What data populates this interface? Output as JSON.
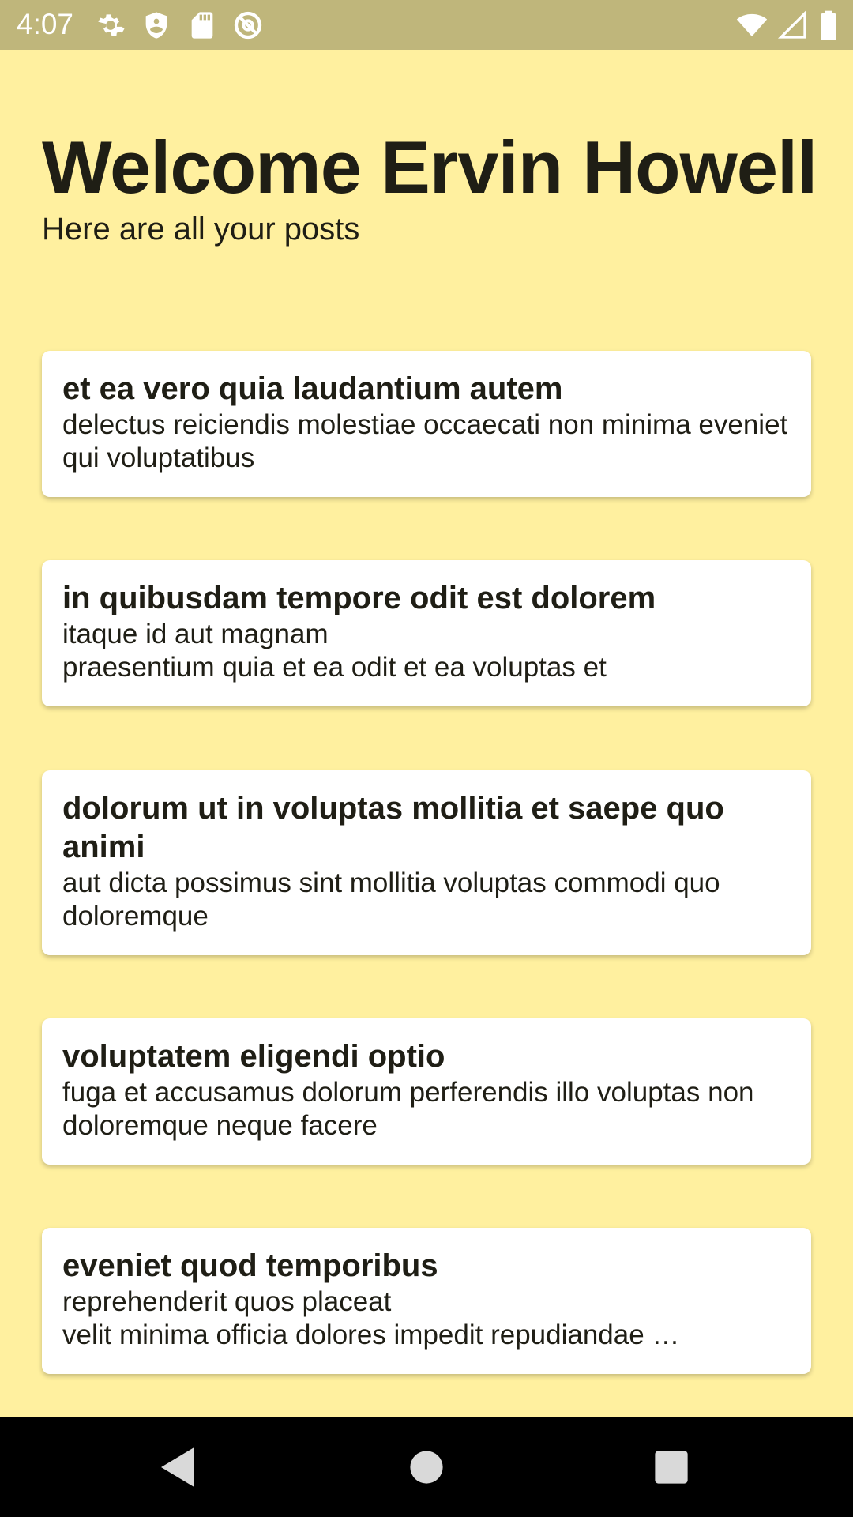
{
  "status_bar": {
    "time": "4:07",
    "left_icons": [
      "settings-gear-icon",
      "shield-icon",
      "sd-card-icon",
      "at-sign-icon"
    ],
    "right_icons": [
      "wifi-icon",
      "cell-signal-icon",
      "battery-icon"
    ]
  },
  "header": {
    "title": "Welcome Ervin Howell",
    "subtitle": "Here are all your posts"
  },
  "posts": [
    {
      "title": "et ea vero quia laudantium autem",
      "body": "delectus reiciendis molestiae occaecati non minima eveniet qui voluptatibus"
    },
    {
      "title": "in quibusdam tempore odit est dolorem",
      "body": "itaque id aut magnam\npraesentium quia et ea odit et ea voluptas et"
    },
    {
      "title": "dolorum ut in voluptas mollitia et saepe quo animi",
      "body": "aut dicta possimus sint mollitia voluptas commodi quo doloremque"
    },
    {
      "title": "voluptatem eligendi optio",
      "body": "fuga et accusamus dolorum perferendis illo voluptas non doloremque neque facere"
    },
    {
      "title": "eveniet quod temporibus",
      "body": "reprehenderit quos placeat\nvelit minima officia dolores impedit repudiandae …"
    }
  ],
  "nav_bar": {
    "buttons": [
      "back-icon",
      "home-icon",
      "recents-icon"
    ]
  },
  "colors": {
    "background": "#FFF09F",
    "status_bar": "#BFB67B",
    "card": "#FFFFFF",
    "text": "#1F1E15"
  }
}
